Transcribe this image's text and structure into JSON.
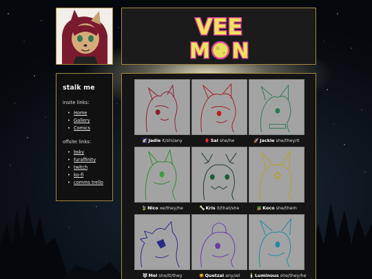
{
  "banner": {
    "logo_line1": "VEE",
    "logo_line2_left": "M",
    "logo_line2_right": "N"
  },
  "sidebar": {
    "title": "stalk me",
    "insite_heading": "insite links:",
    "insite_links": [
      "Home",
      "Gallery",
      "Comics"
    ],
    "offsite_heading": "offsite links:",
    "offsite_links": [
      "bsky",
      "furaffinity",
      "twitch",
      "ko-fi",
      "comms trello"
    ]
  },
  "characters": [
    {
      "emoji": "🌠",
      "name": "Jadie",
      "pronouns": "it/shi/any",
      "line_color": "#8b1f2e",
      "eye_color": "#8b1f2e"
    },
    {
      "emoji": "♦️",
      "name": "Sal",
      "pronouns": "she/he",
      "line_color": "#a11f22",
      "eye_color": "#c21e1e"
    },
    {
      "emoji": "🚀",
      "name": "Jackie",
      "pronouns": "she/they/it",
      "line_color": "#2f7a52",
      "eye_color": "#2f7a52"
    },
    {
      "emoji": "🍃",
      "name": "Nico",
      "pronouns": "xe/they/he",
      "line_color": "#2f8a2f",
      "eye_color": "#3aa03a"
    },
    {
      "emoji": "🦴",
      "name": "Kris",
      "pronouns": "it/that/she",
      "line_color": "#1d3a2a",
      "eye_color": "#1e5b35"
    },
    {
      "emoji": "🪴",
      "name": "Koco",
      "pronouns": "she/them",
      "line_color": "#b8a11e",
      "eye_color": "#b8a11e"
    },
    {
      "emoji": "🐺",
      "name": "Mel",
      "pronouns": "she/it/they",
      "line_color": "#2a2a8a",
      "eye_color": "#2a2a8a"
    },
    {
      "emoji": "☀️",
      "name": "Quetzal",
      "pronouns": "any/all",
      "line_color": "#6a3aa8",
      "eye_color": "#6a3aa8"
    },
    {
      "emoji": "🕯️",
      "name": "Luminous",
      "pronouns": "she/they/he",
      "line_color": "#1d8aa0",
      "eye_color": "#1d8aa0"
    }
  ]
}
